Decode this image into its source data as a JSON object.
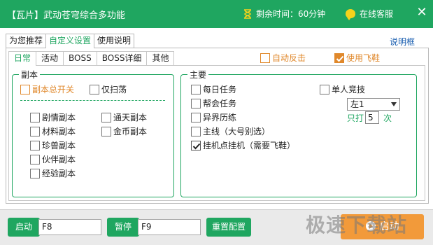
{
  "titlebar": {
    "title": "【瓦片】武动苍穹综合多功能",
    "timer": "剩余时间：60分钟",
    "service": "在线客服",
    "close": "✕"
  },
  "main_tabs": [
    "为您推荐",
    "自定义设置",
    "使用说明"
  ],
  "help_link": "说明框",
  "sub_tabs": [
    "日常",
    "活动",
    "BOSS",
    "BOSS详细",
    "其他"
  ],
  "top_options": {
    "auto_counter": "自动反击",
    "use_shoes": "使用飞鞋"
  },
  "dungeon": {
    "title": "副本",
    "master_switch": "副本总开关",
    "sweep_only": "仅扫荡",
    "items_left": [
      "剧情副本",
      "材料副本",
      "珍兽副本",
      "伙伴副本",
      "经验副本"
    ],
    "items_right": [
      "通天副本",
      "金币副本"
    ]
  },
  "main": {
    "title": "主要",
    "daily_task": "每日任务",
    "guild_task": "帮会任务",
    "trial": "异界历练",
    "main_line": "主线（大号别选）",
    "afk": "挂机点挂机（需要飞鞋）",
    "solo_arena": "单人竞技",
    "select_value": "左1",
    "only_hit": "只打",
    "hit_count": "5",
    "times": "次"
  },
  "bottom": {
    "start_label": "启动",
    "start_key": "F8",
    "pause_label": "暂停",
    "pause_key": "F9",
    "reset_label": "重置配置",
    "run_label": "启动",
    "watermark": "极速下载站"
  },
  "colors": {
    "accent": "#1fa660",
    "orange": "#e0882b",
    "run_button": "#f29a3a"
  }
}
